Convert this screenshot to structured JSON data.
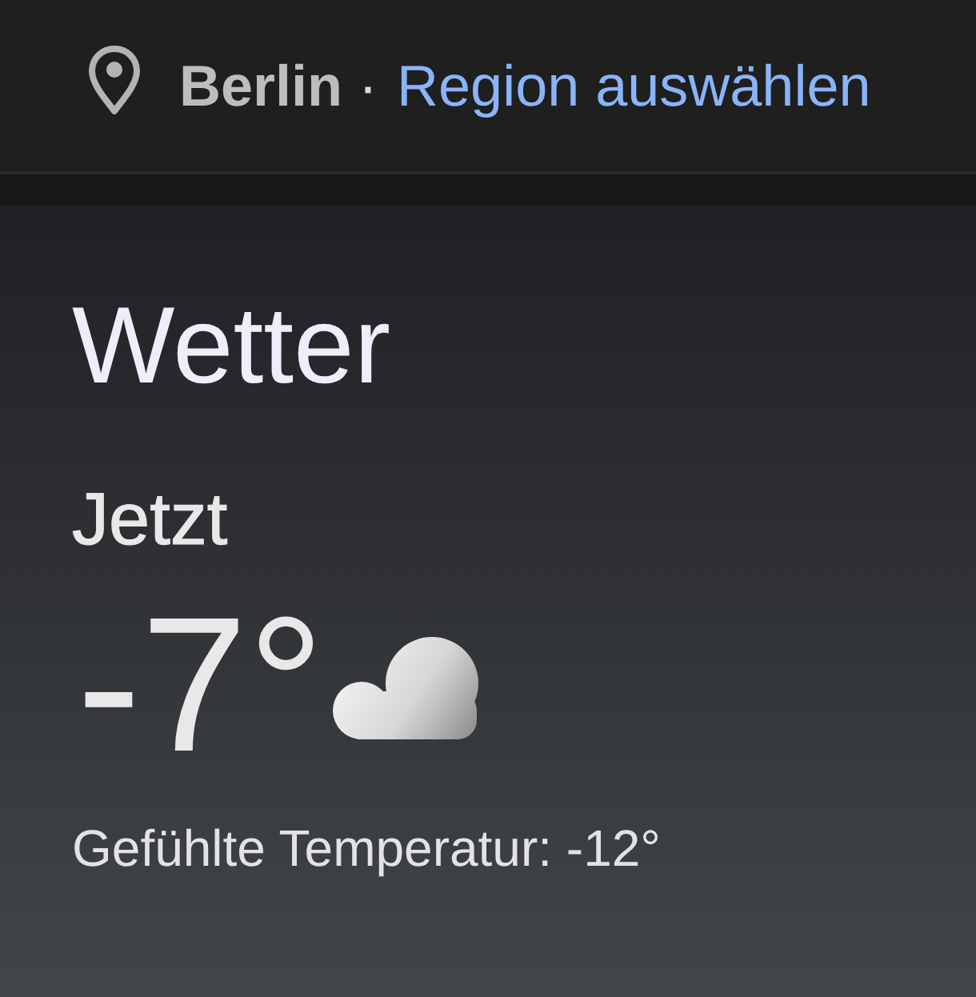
{
  "location": {
    "city": "Berlin",
    "separator": "·",
    "link": "Region auswählen"
  },
  "weather": {
    "title": "Wetter",
    "period": "Jetzt",
    "temperature": "-7°",
    "feels_like": "Gefühlte Temperatur: -12°"
  }
}
